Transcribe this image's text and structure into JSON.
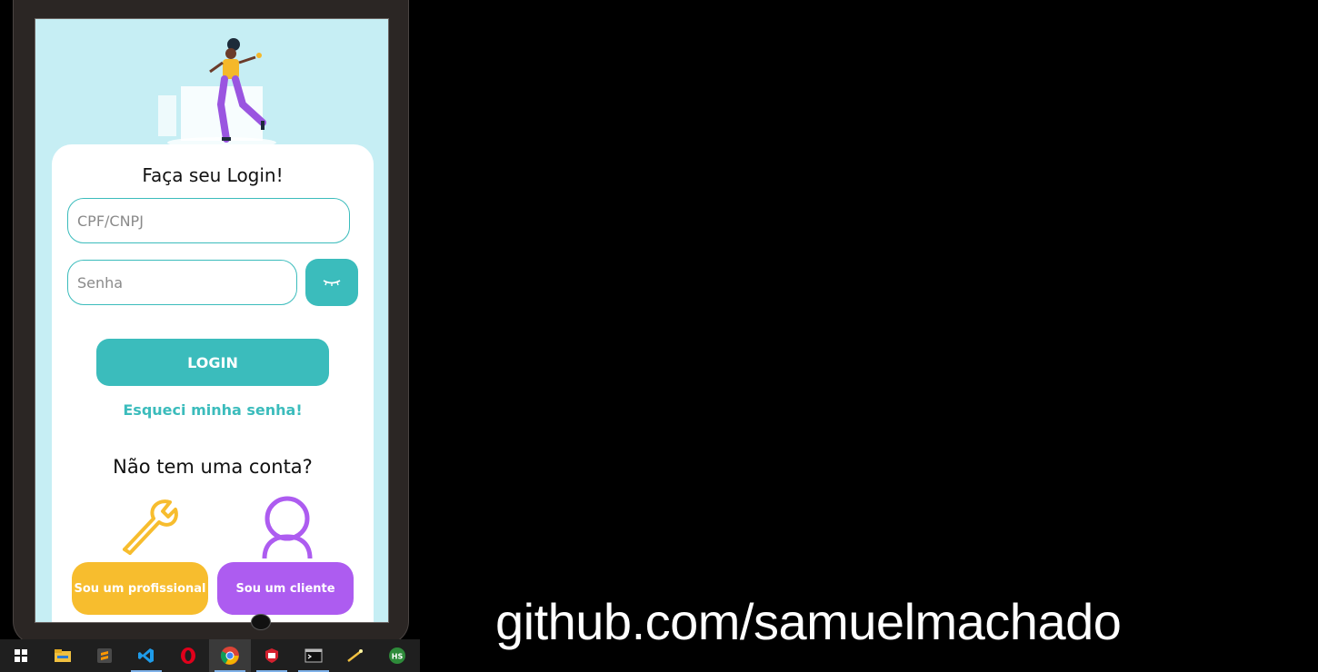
{
  "login": {
    "title": "Faça seu Login!",
    "cpf_placeholder": "CPF/CNPJ",
    "password_placeholder": "Senha",
    "login_button": "LOGIN",
    "forgot_link": "Esqueci minha senha!"
  },
  "signup": {
    "heading": "Não tem uma conta?",
    "professional_button": "Sou um profissional",
    "client_button": "Sou um cliente"
  },
  "colors": {
    "accent": "#3bbcbc",
    "professional": "#f7bd2e",
    "client": "#ad5cf0",
    "screen_bg": "#c6eef4"
  },
  "taskbar": {
    "apps": [
      "windows-start-icon",
      "file-explorer-icon",
      "sublime-text-icon",
      "vscode-icon",
      "opera-icon",
      "chrome-icon",
      "security-app-icon",
      "terminal-icon",
      "app-wand-icon",
      "hs-app-icon"
    ],
    "active_index": 5
  },
  "overlay": {
    "github_text": "github.com/samuelmachado"
  }
}
